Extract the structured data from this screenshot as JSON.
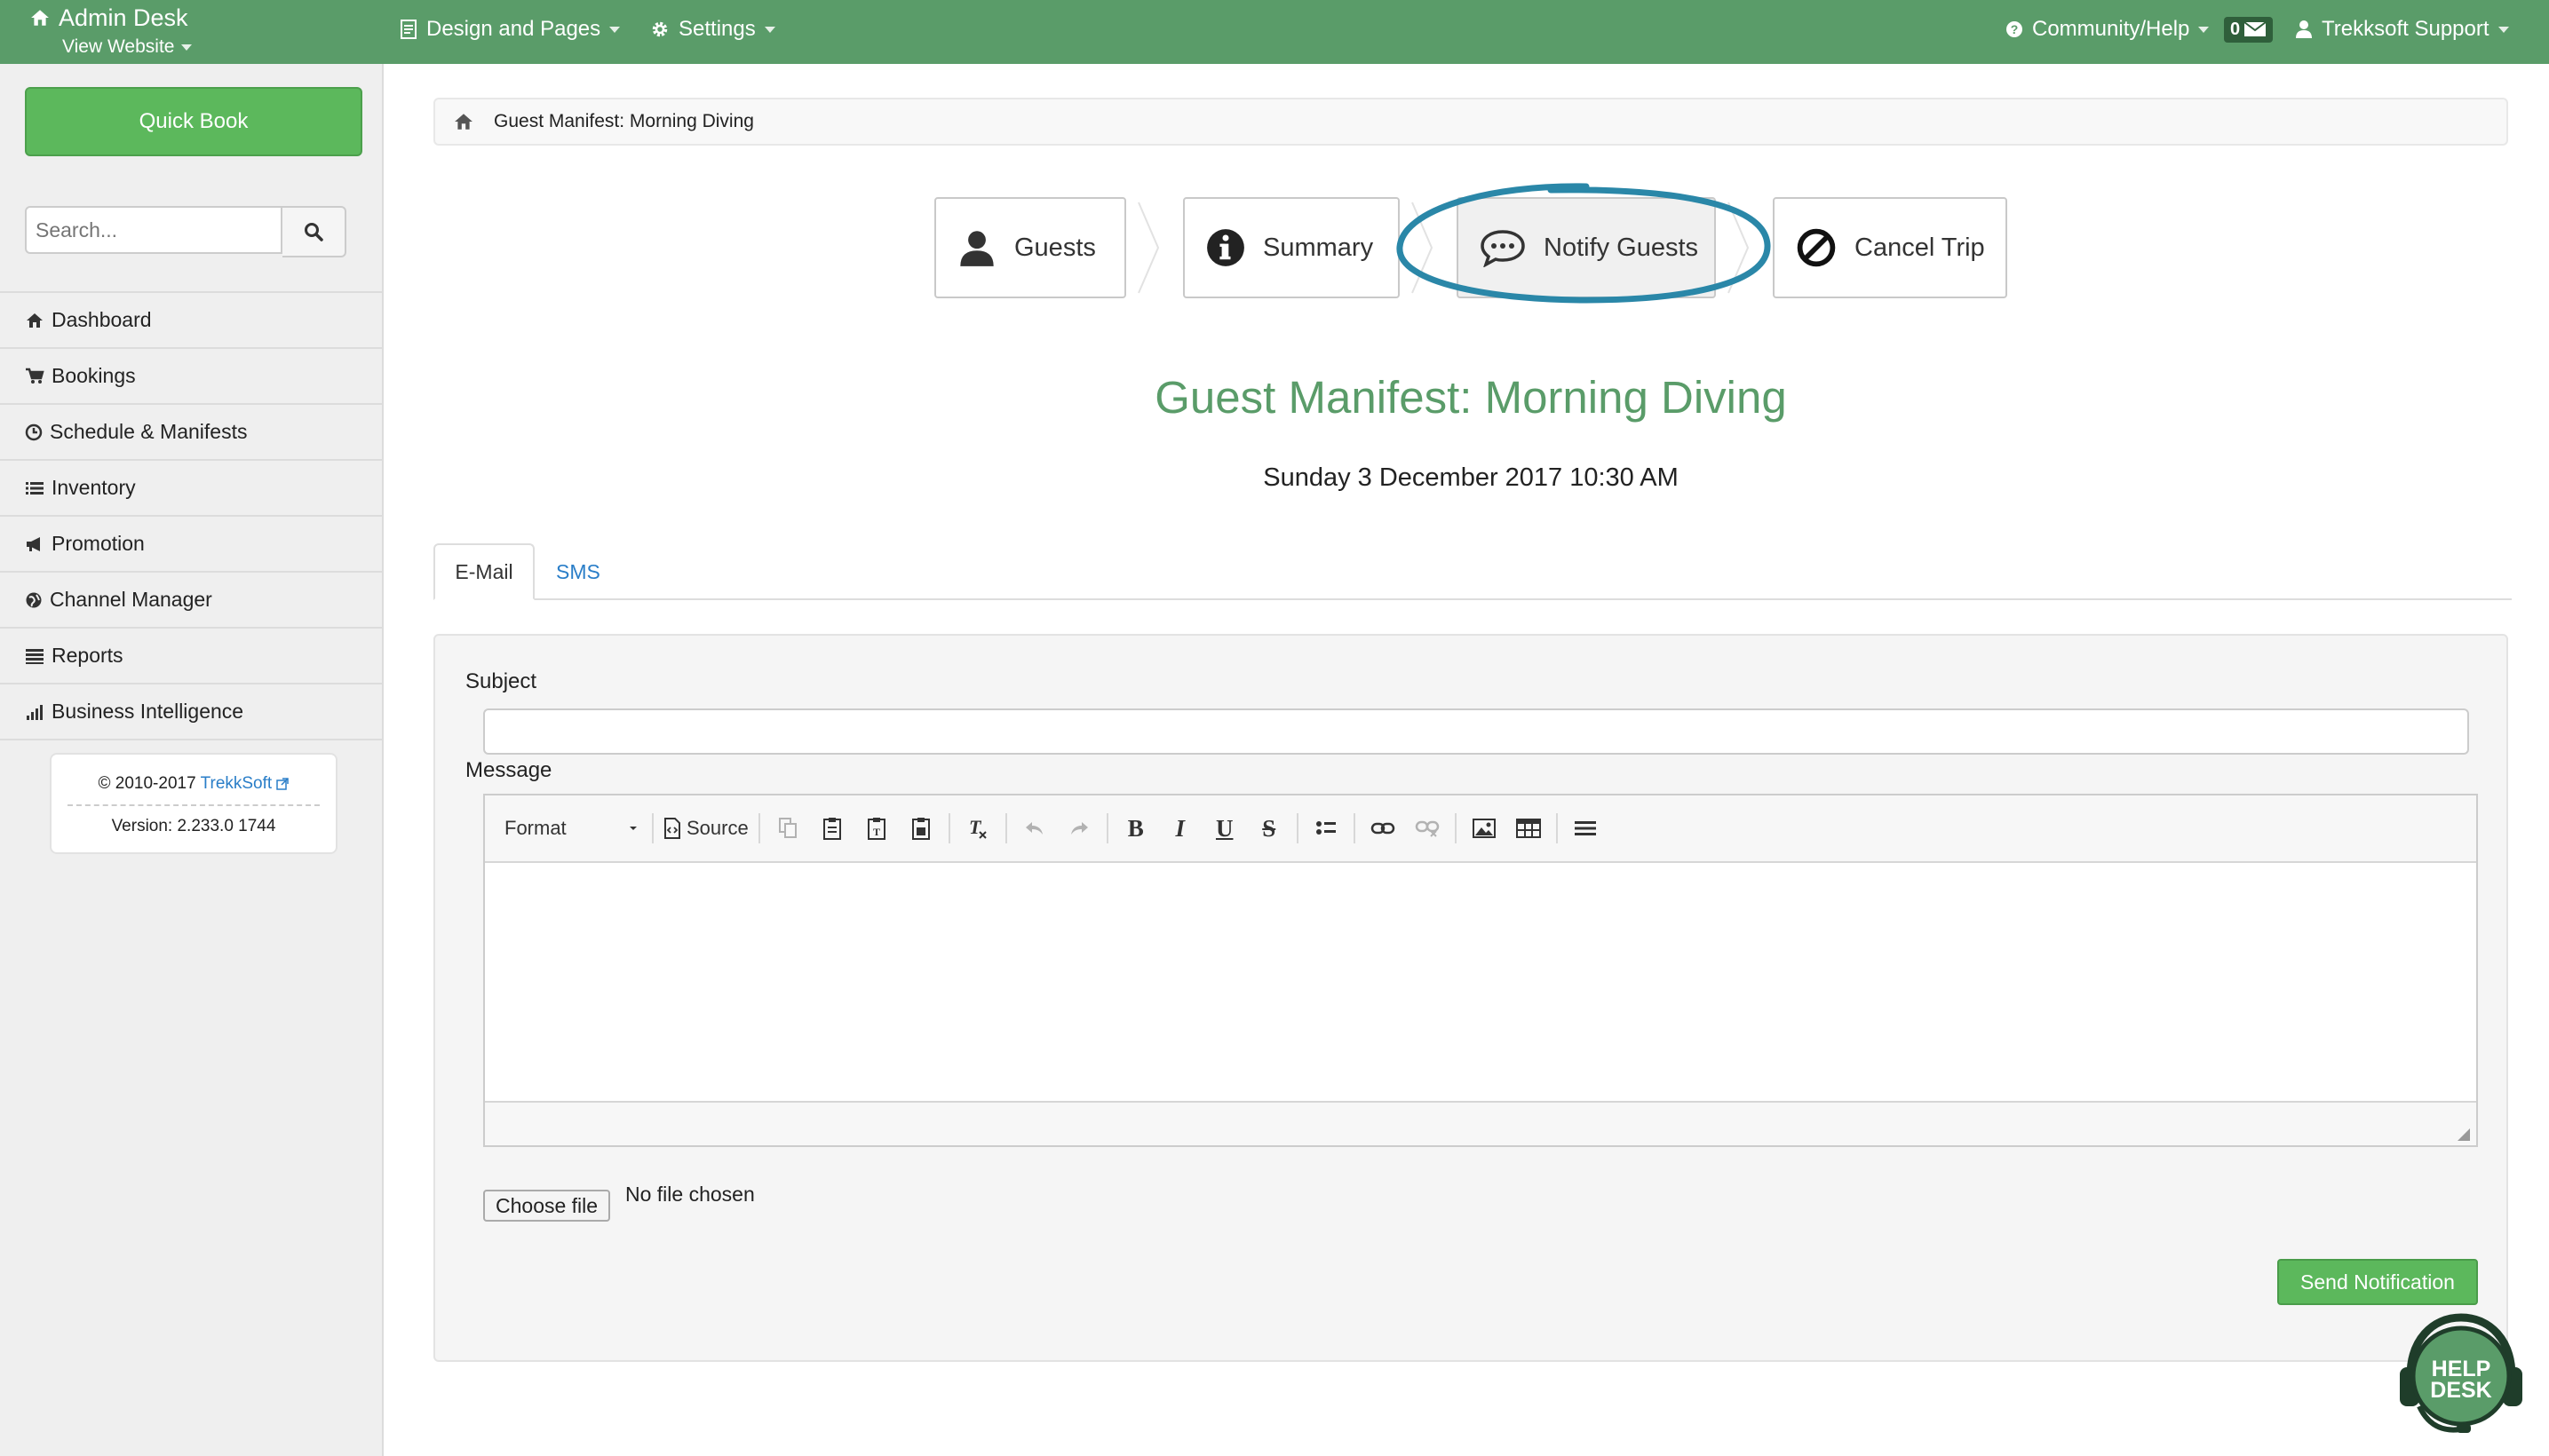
{
  "topbar": {
    "brand_title": "Admin Desk",
    "view_website": "View Website",
    "design_pages": "Design and Pages",
    "settings": "Settings",
    "community_help": "Community/Help",
    "mail_count": "0",
    "user": "Trekksoft Support",
    "bg_color": "#5a9c69"
  },
  "sidebar": {
    "quick_book": "Quick Book",
    "search_placeholder": "Search...",
    "items": [
      {
        "label": "Dashboard",
        "icon": "home-icon"
      },
      {
        "label": "Bookings",
        "icon": "cart-icon"
      },
      {
        "label": "Schedule & Manifests",
        "icon": "clock-icon"
      },
      {
        "label": "Inventory",
        "icon": "list-icon"
      },
      {
        "label": "Promotion",
        "icon": "megaphone-icon"
      },
      {
        "label": "Channel Manager",
        "icon": "globe-icon"
      },
      {
        "label": "Reports",
        "icon": "report-icon"
      },
      {
        "label": "Business Intelligence",
        "icon": "bar-chart-icon"
      }
    ],
    "copyright_prefix": "© 2010-2017",
    "copyright_link": "TrekkSoft",
    "version": "Version: 2.233.0 1744"
  },
  "breadcrumb": {
    "current": "Guest Manifest: Morning Diving"
  },
  "steps": [
    {
      "label": "Guests",
      "icon": "user-icon"
    },
    {
      "label": "Summary",
      "icon": "info-icon"
    },
    {
      "label": "Notify Guests",
      "icon": "chat-icon",
      "active": true
    },
    {
      "label": "Cancel Trip",
      "icon": "ban-icon"
    }
  ],
  "page": {
    "title": "Guest Manifest: Morning Diving",
    "date": "Sunday 3 December 2017 10:30 AM",
    "title_color": "#5a9c69"
  },
  "tabs": {
    "email": "E-Mail",
    "sms": "SMS"
  },
  "form": {
    "subject_label": "Subject",
    "subject_value": "",
    "message_label": "Message",
    "format_label": "Format",
    "source_label": "Source",
    "choose_file": "Choose file",
    "no_file": "No file chosen",
    "send": "Send Notification",
    "send_color": "#5cb85c"
  },
  "helpdesk": {
    "line1": "HELP",
    "line2": "DESK"
  },
  "highlight_color": "#2a87a8"
}
